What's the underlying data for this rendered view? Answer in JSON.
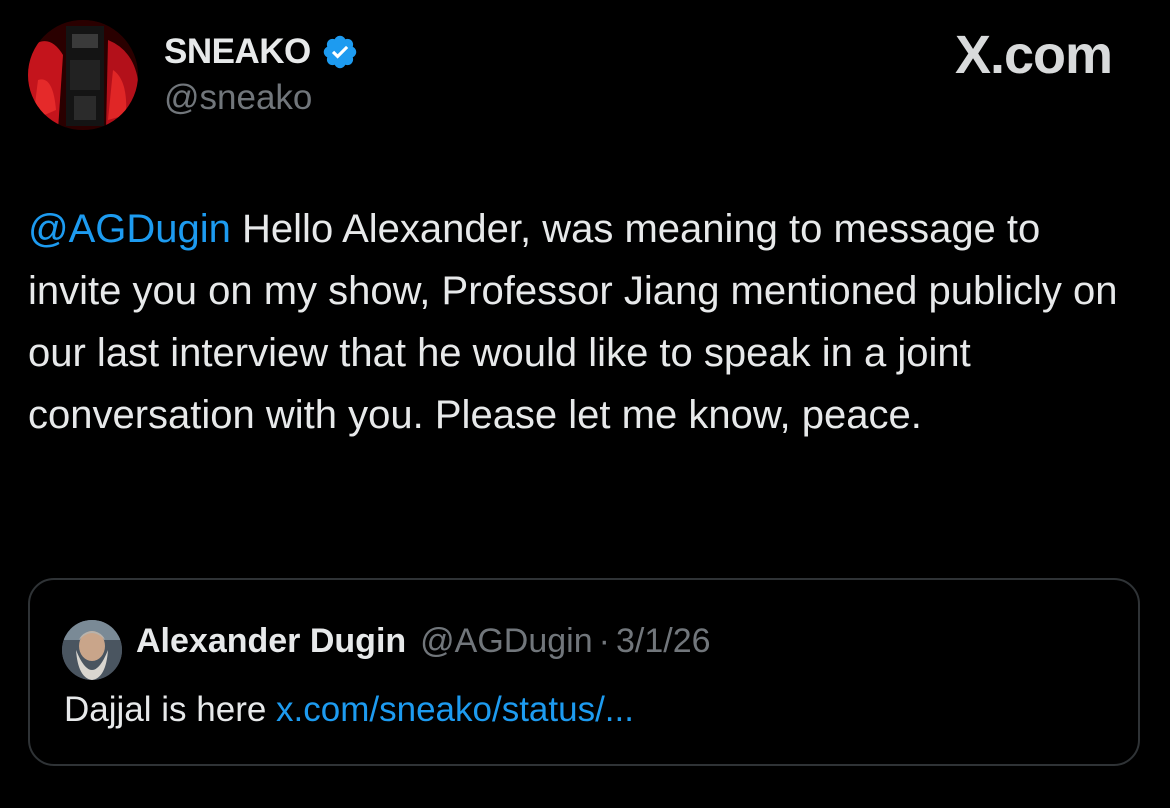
{
  "author": {
    "display_name": "SNEAKO",
    "handle": "@sneako",
    "verified": true,
    "avatar_icon": "profile-photo-red"
  },
  "watermark": "X.com",
  "tweet": {
    "mention": "@AGDugin",
    "text": " Hello Alexander, was meaning to message to invite you on my show, Professor Jiang mentioned publicly on our last interview that he would like to speak in a joint conversation with you. Please let me know, peace."
  },
  "quoted_tweet": {
    "display_name": "Alexander Dugin",
    "handle": "@AGDugin",
    "separator": "·",
    "date": "3/1/26",
    "text": "Dajjal is here ",
    "link": "x.com/sneako/status/..."
  },
  "colors": {
    "background": "#000000",
    "text": "#e7e9ea",
    "secondary": "#71767b",
    "accent": "#1d9bf0",
    "border": "#2f3336"
  }
}
